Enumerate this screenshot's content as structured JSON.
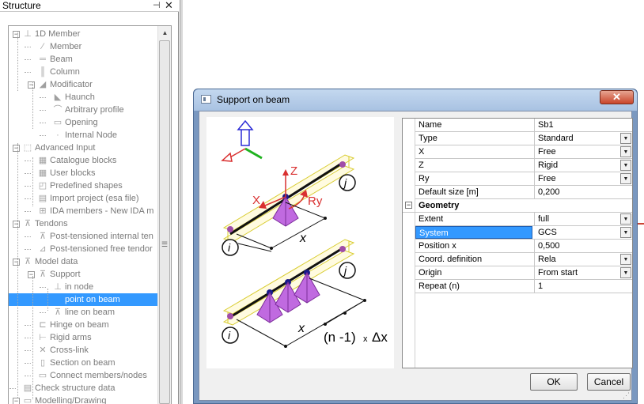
{
  "panel": {
    "title": "Structure",
    "pin_icon": "pin-icon",
    "close_icon": "close-icon"
  },
  "tree": {
    "items": [
      {
        "label": "1D Member",
        "icon": "1d-member-icon"
      },
      {
        "label": "Member",
        "icon": "member-icon"
      },
      {
        "label": "Beam",
        "icon": "beam-icon"
      },
      {
        "label": "Column",
        "icon": "column-icon"
      },
      {
        "label": "Modificator",
        "icon": "modificator-icon"
      },
      {
        "label": "Haunch",
        "icon": "haunch-icon"
      },
      {
        "label": "Arbitrary profile",
        "icon": "arbitrary-profile-icon"
      },
      {
        "label": "Opening",
        "icon": "opening-icon"
      },
      {
        "label": "Internal Node",
        "icon": "internal-node-icon"
      },
      {
        "label": "Advanced Input",
        "icon": "advanced-input-icon"
      },
      {
        "label": "Catalogue blocks",
        "icon": "catalogue-blocks-icon"
      },
      {
        "label": "User blocks",
        "icon": "user-blocks-icon"
      },
      {
        "label": "Predefined shapes",
        "icon": "predefined-shapes-icon"
      },
      {
        "label": "Import project (esa file)",
        "icon": "import-project-icon"
      },
      {
        "label": "IDA members - New IDA m",
        "icon": "ida-members-icon"
      },
      {
        "label": "Tendons",
        "icon": "tendons-icon"
      },
      {
        "label": "Post-tensioned internal ten",
        "icon": "internal-tendon-icon"
      },
      {
        "label": "Post-tensioned free tendor",
        "icon": "free-tendon-icon"
      },
      {
        "label": "Model data",
        "icon": "model-data-icon"
      },
      {
        "label": "Support",
        "icon": "support-icon"
      },
      {
        "label": "in node",
        "icon": "support-node-icon"
      },
      {
        "label": "point on beam",
        "icon": "point-on-beam-icon"
      },
      {
        "label": "line on beam",
        "icon": "line-on-beam-icon"
      },
      {
        "label": "Hinge on beam",
        "icon": "hinge-icon"
      },
      {
        "label": "Rigid arms",
        "icon": "rigid-arms-icon"
      },
      {
        "label": "Cross-link",
        "icon": "cross-link-icon"
      },
      {
        "label": "Section on beam",
        "icon": "section-icon"
      },
      {
        "label": "Connect members/nodes",
        "icon": "connect-icon"
      },
      {
        "label": "Check structure data",
        "icon": "check-data-icon"
      },
      {
        "label": "Modelling/Drawing",
        "icon": "modelling-icon"
      }
    ],
    "selected": "point on beam"
  },
  "dialog": {
    "title": "Support on beam",
    "close_label": "✕",
    "ok_label": "OK",
    "cancel_label": "Cancel",
    "illustration": {
      "axis_z": "Z",
      "axis_x": "X",
      "axis_ry": "Ry",
      "node_i": "i",
      "node_j": "j",
      "dim_x": "x",
      "repeat_formula_prefix": "(n -1)",
      "repeat_formula_times": "x",
      "repeat_formula_delta": "Δx"
    },
    "properties": [
      {
        "name": "Name",
        "value": "Sb1",
        "dropdown": false
      },
      {
        "name": "Type",
        "value": "Standard",
        "dropdown": true
      },
      {
        "name": "X",
        "value": "Free",
        "dropdown": true
      },
      {
        "name": "Z",
        "value": "Rigid",
        "dropdown": true
      },
      {
        "name": "Ry",
        "value": "Free",
        "dropdown": true
      },
      {
        "name": "Default size [m]",
        "value": "0,200",
        "dropdown": false
      }
    ],
    "group": {
      "label": "Geometry",
      "toggle": "−"
    },
    "geometry": [
      {
        "name": "Extent",
        "value": "full",
        "dropdown": true
      },
      {
        "name": "System",
        "value": "GCS",
        "dropdown": true
      },
      {
        "name": "Position x",
        "value": "0,500",
        "dropdown": false
      },
      {
        "name": "Coord. definition",
        "value": "Rela",
        "dropdown": true
      },
      {
        "name": "Origin",
        "value": "From start",
        "dropdown": true
      },
      {
        "name": "Repeat (n)",
        "value": "1",
        "dropdown": false
      }
    ],
    "selected_property": "System"
  },
  "colors": {
    "selection": "#3399ff",
    "support": "#b44fe0",
    "beam": "#e8e050",
    "node": "#1a1a8a"
  }
}
